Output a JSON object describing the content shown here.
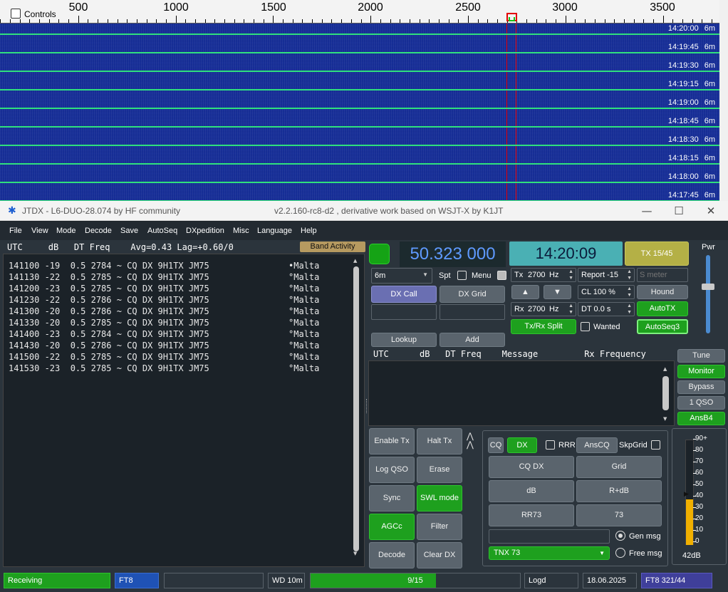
{
  "waterfall": {
    "controls_label": "Controls",
    "scale_labels": [
      "500",
      "1000",
      "1500",
      "2000",
      "2500",
      "3000",
      "3500"
    ],
    "rows": [
      {
        "time": "14:20:00",
        "band": "6m"
      },
      {
        "time": "14:19:45",
        "band": "6m"
      },
      {
        "time": "14:19:30",
        "band": "6m"
      },
      {
        "time": "14:19:15",
        "band": "6m"
      },
      {
        "time": "14:19:00",
        "band": "6m"
      },
      {
        "time": "14:18:45",
        "band": "6m"
      },
      {
        "time": "14:18:30",
        "band": "6m"
      },
      {
        "time": "14:18:15",
        "band": "6m"
      },
      {
        "time": "14:18:00",
        "band": "6m"
      },
      {
        "time": "14:17:45",
        "band": "6m"
      }
    ]
  },
  "window": {
    "title": "JTDX - L6-DUO-28.074  by HF community",
    "version": "v2.2.160-rc8-d2 , derivative work based on WSJT-X by K1JT"
  },
  "menu": [
    "File",
    "View",
    "Mode",
    "Decode",
    "Save",
    "AutoSeq",
    "DXpedition",
    "Misc",
    "Language",
    "Help"
  ],
  "band_activity": {
    "header": "UTC     dB   DT Freq    Avg=0.43 Lag=+0.60/0",
    "button": "Band Activity",
    "rows": [
      {
        "text": "141100 -19  0.5 2784 ~ CQ DX 9H1TX JM75",
        "country": "•Malta"
      },
      {
        "text": "141130 -22  0.5 2785 ~ CQ DX 9H1TX JM75",
        "country": "°Malta"
      },
      {
        "text": "141200 -23  0.5 2785 ~ CQ DX 9H1TX JM75",
        "country": "°Malta"
      },
      {
        "text": "141230 -22  0.5 2786 ~ CQ DX 9H1TX JM75",
        "country": "°Malta"
      },
      {
        "text": "141300 -20  0.5 2786 ~ CQ DX 9H1TX JM75",
        "country": "°Malta"
      },
      {
        "text": "141330 -20  0.5 2785 ~ CQ DX 9H1TX JM75",
        "country": "°Malta"
      },
      {
        "text": "141400 -23  0.5 2784 ~ CQ DX 9H1TX JM75",
        "country": "°Malta"
      },
      {
        "text": "141430 -20  0.5 2786 ~ CQ DX 9H1TX JM75",
        "country": "°Malta"
      },
      {
        "text": "141500 -22  0.5 2785 ~ CQ DX 9H1TX JM75",
        "country": "°Malta"
      },
      {
        "text": "141530 -23  0.5 2785 ~ CQ DX 9H1TX JM75",
        "country": "°Malta"
      }
    ]
  },
  "controls": {
    "frequency": "50.323 000",
    "clock": "14:20:09",
    "tx_period": "TX 15/45",
    "pwr_label": "Pwr",
    "band": "6m",
    "spt_label": "Spt",
    "menu_label": "Menu",
    "tx_label": "Tx",
    "tx_freq": "2700",
    "hz": "Hz",
    "report": "Report -15",
    "s_meter_placeholder": "S meter",
    "dx_call": "DX Call",
    "dx_grid": "DX Grid",
    "up_arrow": "▲",
    "down_arrow": "▼",
    "cl": "CL  100 %",
    "hound": "Hound",
    "rx_label": "Rx",
    "rx_freq": "2700",
    "dt": "DT 0.0 s",
    "autotx": "AutoTX",
    "tx_rx_split": "Tx/Rx Split",
    "wanted": "Wanted",
    "autoseq3": "AutoSeq3",
    "lookup": "Lookup",
    "add": "Add"
  },
  "rx_frequency": {
    "header": "UTC      dB   DT Freq    Message         Rx Frequency"
  },
  "side_buttons": [
    "Tune",
    "Monitor",
    "Bypass",
    "1 QSO",
    "AnsB4"
  ],
  "action_buttons": [
    [
      "Enable Tx",
      "Halt Tx"
    ],
    [
      "Log QSO",
      "Erase"
    ],
    [
      "Sync",
      "SWL mode"
    ],
    [
      "AGCc",
      "Filter"
    ],
    [
      "Decode",
      "Clear DX"
    ]
  ],
  "messages": {
    "cq": "CQ",
    "dx": "DX",
    "rrr": "RRR",
    "anscq": "AnsCQ",
    "skpgrid": "SkpGrid",
    "cq_dx": "CQ DX",
    "grid": "Grid",
    "db": "dB",
    "r_db": "R+dB",
    "rr73": "RR73",
    "s73": "73",
    "tnx": "TNX 73",
    "gen_msg": "Gen msg",
    "free_msg": "Free msg"
  },
  "meter": {
    "labels": [
      "90+",
      "80",
      "70",
      "60",
      "50",
      "40",
      "30",
      "20",
      "10",
      "0"
    ],
    "level": 0.55,
    "db_readout": "42dB"
  },
  "status": {
    "state": "Receiving",
    "mode": "FT8",
    "wd": "WD 10m",
    "progress_text": "9/15",
    "progress": 0.6,
    "log": "Logd",
    "date": "18.06.2025",
    "mode_count": "FT8  321/44"
  },
  "colors": {
    "accent_green": "#1ea01e",
    "waterfall_blue": "#13298f",
    "clock_teal": "#4ab0b4",
    "freq_blue": "#5f9aff"
  }
}
